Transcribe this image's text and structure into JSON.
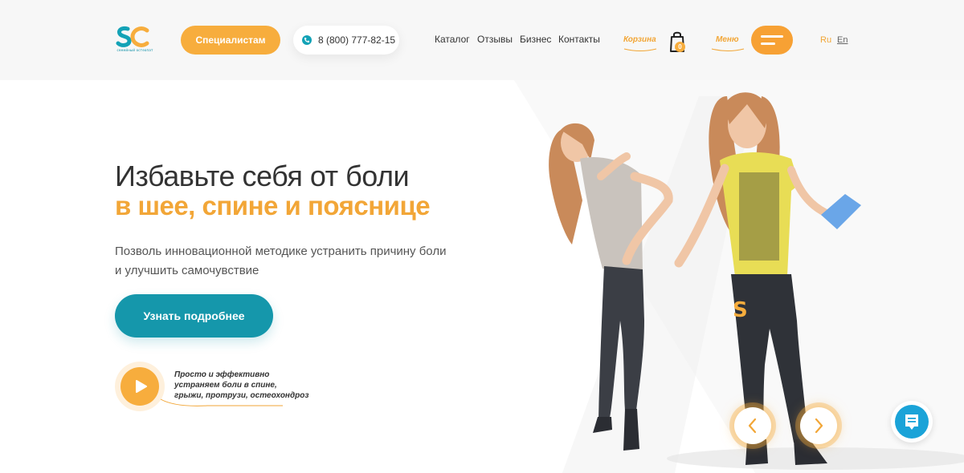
{
  "header": {
    "logo_text": "SC",
    "logo_subtitle": "семейный остеопат",
    "specialists_label": "Специалистам",
    "phone": "8 (800) 777-82-15",
    "nav": [
      "Каталог",
      "Отзывы",
      "Бизнес",
      "Контакты"
    ],
    "cart_label": "Корзина",
    "cart_count": "0",
    "menu_label": "Меню",
    "lang_ru": "Ru",
    "lang_en": "En"
  },
  "hero": {
    "title": "Избавьте себя от боли",
    "title_accent": "в шее, спине и пояснице",
    "subtitle": "Позволь инновационной методике устранить причину боли и улучшить самочувствие",
    "cta_label": "Узнать подробнее",
    "video_caption_lines": [
      "Просто и эффективно",
      "устраняем боли в спине,",
      "грыжи, протрузи, остеохондроз"
    ]
  },
  "icons": {
    "phone": "phone-icon",
    "bag": "shopping-bag-icon",
    "menu": "hamburger-icon",
    "play": "play-icon",
    "prev": "chevron-left-icon",
    "next": "chevron-right-icon",
    "chat": "chat-icon"
  },
  "colors": {
    "accent_orange": "#f7ad3d",
    "accent_teal": "#1597ab",
    "chat_blue": "#1aa3d8",
    "text_dark": "#333333"
  }
}
